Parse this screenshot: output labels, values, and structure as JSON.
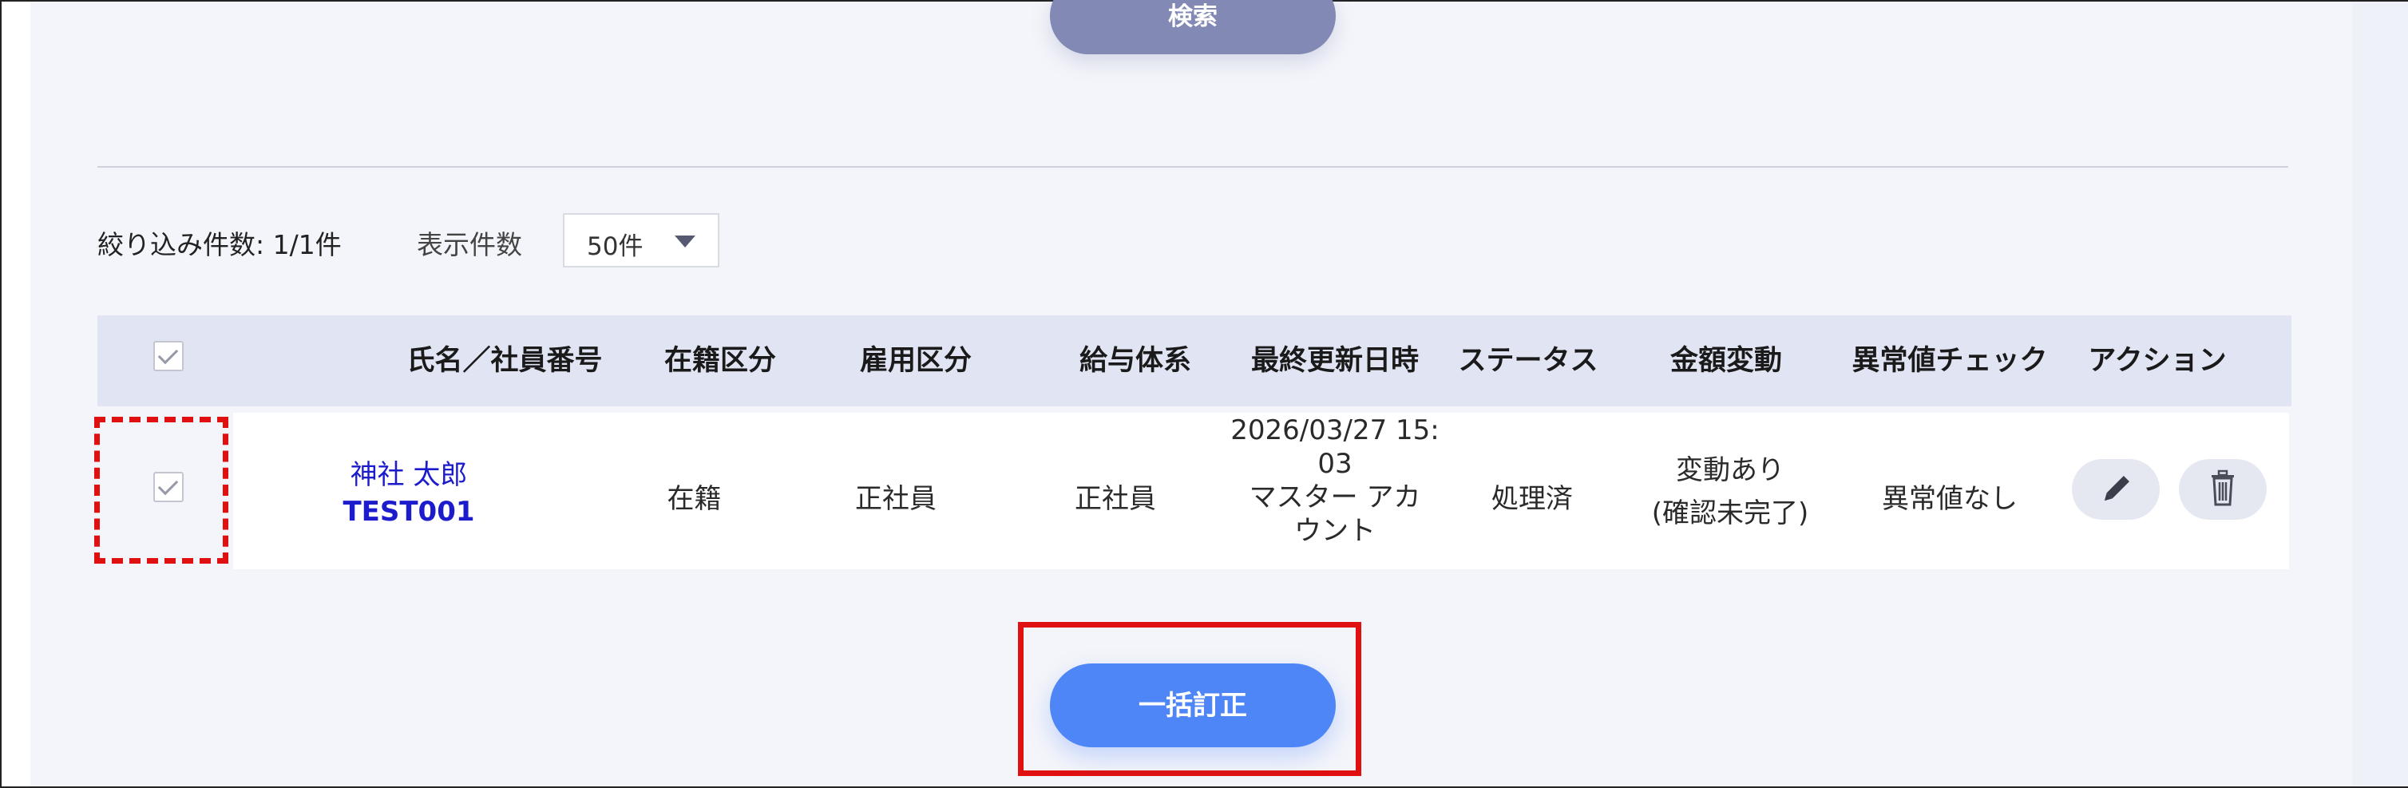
{
  "search": {
    "button_label": "検索"
  },
  "filter": {
    "result_count_label": "絞り込み件数: 1/1件",
    "per_page_label": "表示件数",
    "per_page_value": "50件"
  },
  "table": {
    "headers": {
      "name_id": "氏名／社員番号",
      "enrollment": "在籍区分",
      "employment": "雇用区分",
      "pay_system": "給与体系",
      "last_updated": "最終更新日時",
      "status": "ステータス",
      "amount_change": "金額変動",
      "anomaly_check": "異常値チェック",
      "action": "アクション"
    },
    "rows": [
      {
        "name": "神社 太郎",
        "employee_id": "TEST001",
        "enrollment": "在籍",
        "employment": "正社員",
        "pay_system": "正社員",
        "last_updated_line1": "2026/03/27 15:",
        "last_updated_line2": "03",
        "updated_by_line1": "マスター アカ",
        "updated_by_line2": "ウント",
        "status": "処理済",
        "amount_change_line1": "変動あり",
        "amount_change_line2": "(確認未完了)",
        "anomaly_check": "異常値なし"
      }
    ]
  },
  "bulk": {
    "button_label": "一括訂正"
  },
  "colors": {
    "primary": "#4f86f7",
    "search_button": "#8289b4",
    "link": "#1c1ccc",
    "highlight": "#e01010",
    "header_bg": "#e1e4f2"
  }
}
